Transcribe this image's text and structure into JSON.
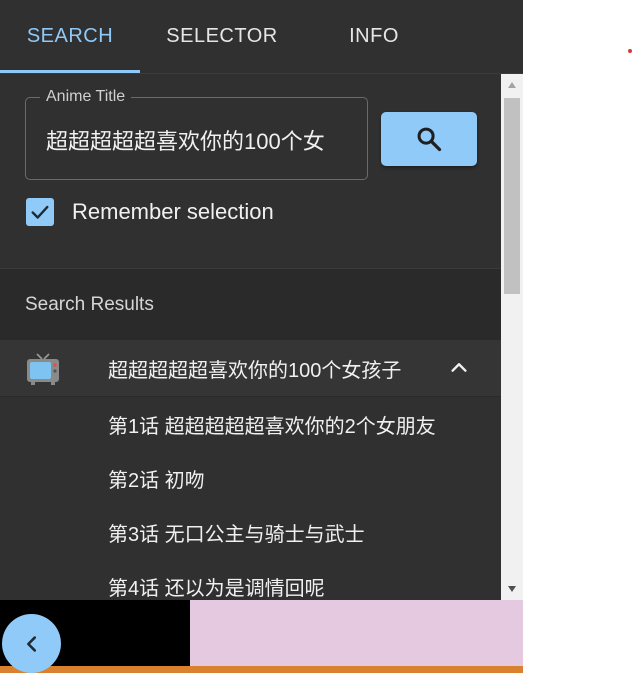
{
  "tabs": [
    {
      "label": "SEARCH",
      "active": true
    },
    {
      "label": "SELECTOR",
      "active": false
    },
    {
      "label": "INFO",
      "active": false
    }
  ],
  "search": {
    "field_label": "Anime Title",
    "field_value": "超超超超超喜欢你的100个女"
  },
  "remember": {
    "checked": true,
    "label": "Remember selection"
  },
  "results": {
    "header": "Search Results",
    "anime": {
      "title": "超超超超超喜欢你的100个女孩子",
      "icon": "tv-icon",
      "expanded": true
    },
    "episodes": [
      "第1话 超超超超超喜欢你的2个女朋友",
      "第2话 初吻",
      "第3话 无口公主与骑士与武士",
      "第4话 还以为是调情回呢"
    ]
  },
  "colors": {
    "accent": "#90caf9",
    "panel_bg": "#303030",
    "results_header_bg": "#2a2a2a"
  }
}
